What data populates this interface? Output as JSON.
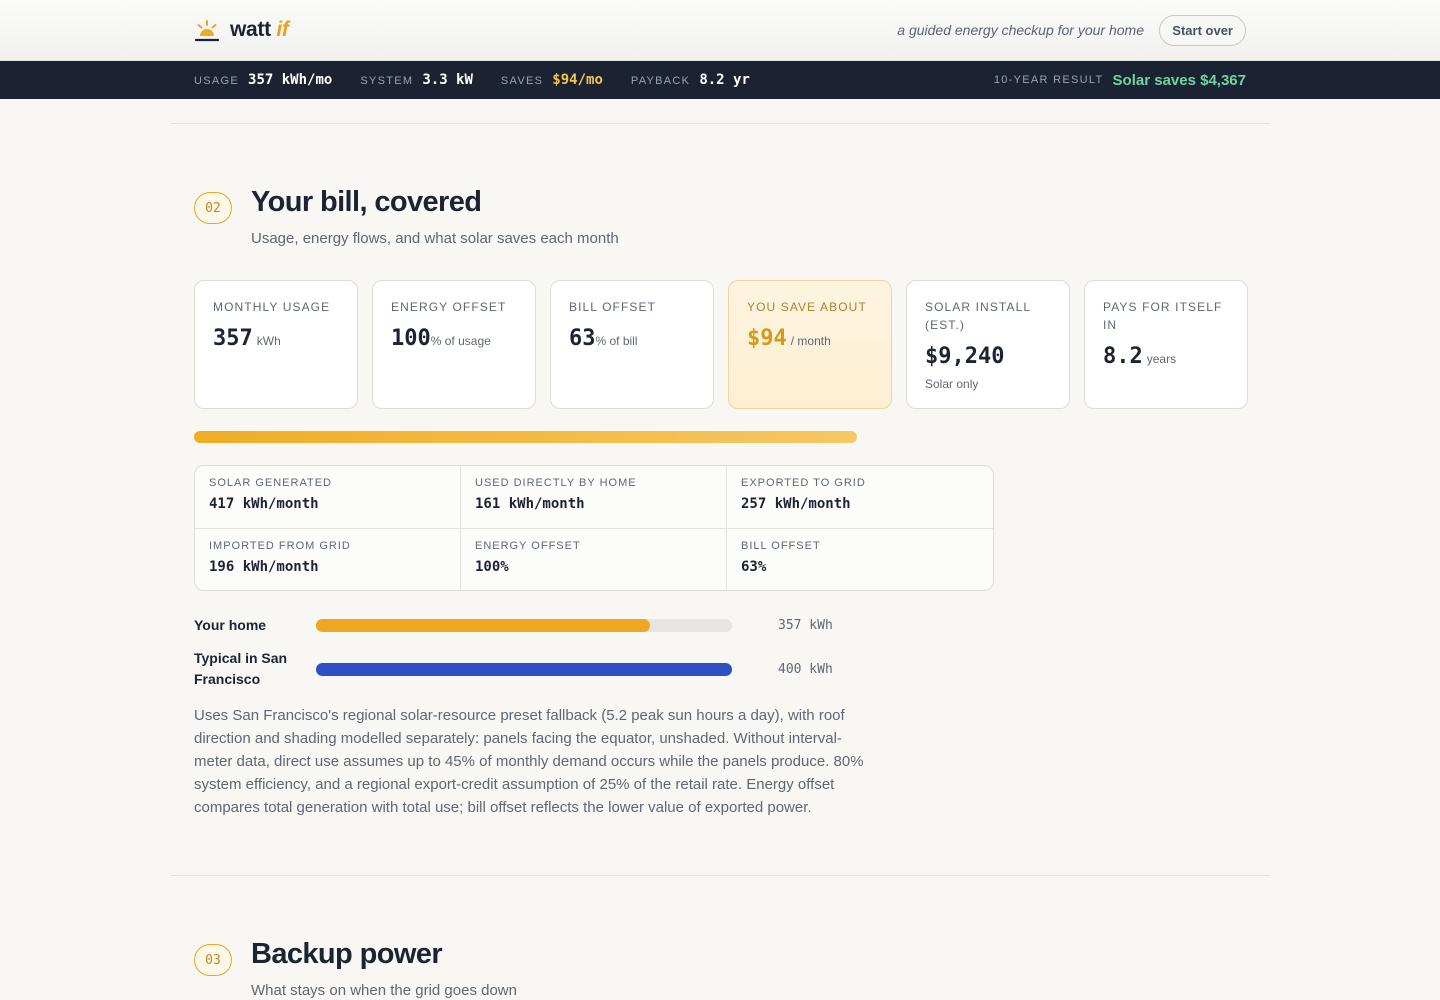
{
  "header": {
    "brand_main": "watt",
    "brand_accent": "if",
    "tagline": "a guided energy checkup for your home",
    "start_over": "Start over",
    "icon": "sun-icon"
  },
  "strip": {
    "stats": [
      {
        "label": "USAGE",
        "value": "357 kWh/mo"
      },
      {
        "label": "SYSTEM",
        "value": "3.3 kW"
      },
      {
        "label": "SAVES",
        "value": "$94/mo"
      },
      {
        "label": "PAYBACK",
        "value": "8.2 yr"
      }
    ],
    "result_label": "10-YEAR RESULT",
    "result_value": "Solar saves $4,367"
  },
  "section2": {
    "number": "02",
    "title": "Your bill, covered",
    "subtitle": "Usage, energy flows, and what solar saves each month",
    "cards": [
      {
        "label": "MONTHLY USAGE",
        "value": "357",
        "unit": "kWh"
      },
      {
        "label": "ENERGY OFFSET",
        "value": "100",
        "unit": "% of usage"
      },
      {
        "label": "BILL OFFSET",
        "value": "63",
        "unit": "% of bill"
      },
      {
        "label": "YOU SAVE ABOUT",
        "value": "$94",
        "unit": "/ month"
      },
      {
        "label": "SOLAR INSTALL (EST.)",
        "value": "$9,240",
        "note": "Solar only"
      },
      {
        "label": "PAYS FOR ITSELF IN",
        "value": "8.2",
        "unit": "years"
      }
    ],
    "bill_offset_fraction": 0.63,
    "flows": [
      {
        "label": "SOLAR GENERATED",
        "value": "417 kWh/month"
      },
      {
        "label": "USED DIRECTLY BY HOME",
        "value": "161 kWh/month"
      },
      {
        "label": "EXPORTED TO GRID",
        "value": "257 kWh/month"
      },
      {
        "label": "IMPORTED FROM GRID",
        "value": "196 kWh/month"
      },
      {
        "label": "ENERGY OFFSET",
        "value": "100%"
      },
      {
        "label": "BILL OFFSET",
        "value": "63%"
      }
    ],
    "comparison": [
      {
        "label": "Your home",
        "value": "357 kWh",
        "kwh": 357,
        "color": "#eea823"
      },
      {
        "label": "Typical in San Francisco",
        "value": "400 kWh",
        "kwh": 400,
        "color": "#2e4fc4"
      }
    ],
    "comparison_max_kwh": 400,
    "explanation": "Uses San Francisco's regional solar-resource preset fallback (5.2 peak sun hours a day), with roof direction and shading modelled separately: panels facing the equator, unshaded. Without interval-meter data, direct use assumes up to 45% of monthly demand occurs while the panels produce. 80% system efficiency, and a regional export-credit assumption of 25% of the retail rate. Energy offset compares total generation with total use; bill offset reflects the lower value of exported power."
  },
  "section3": {
    "number": "03",
    "title": "Backup power",
    "subtitle": "What stays on when the grid goes down"
  }
}
